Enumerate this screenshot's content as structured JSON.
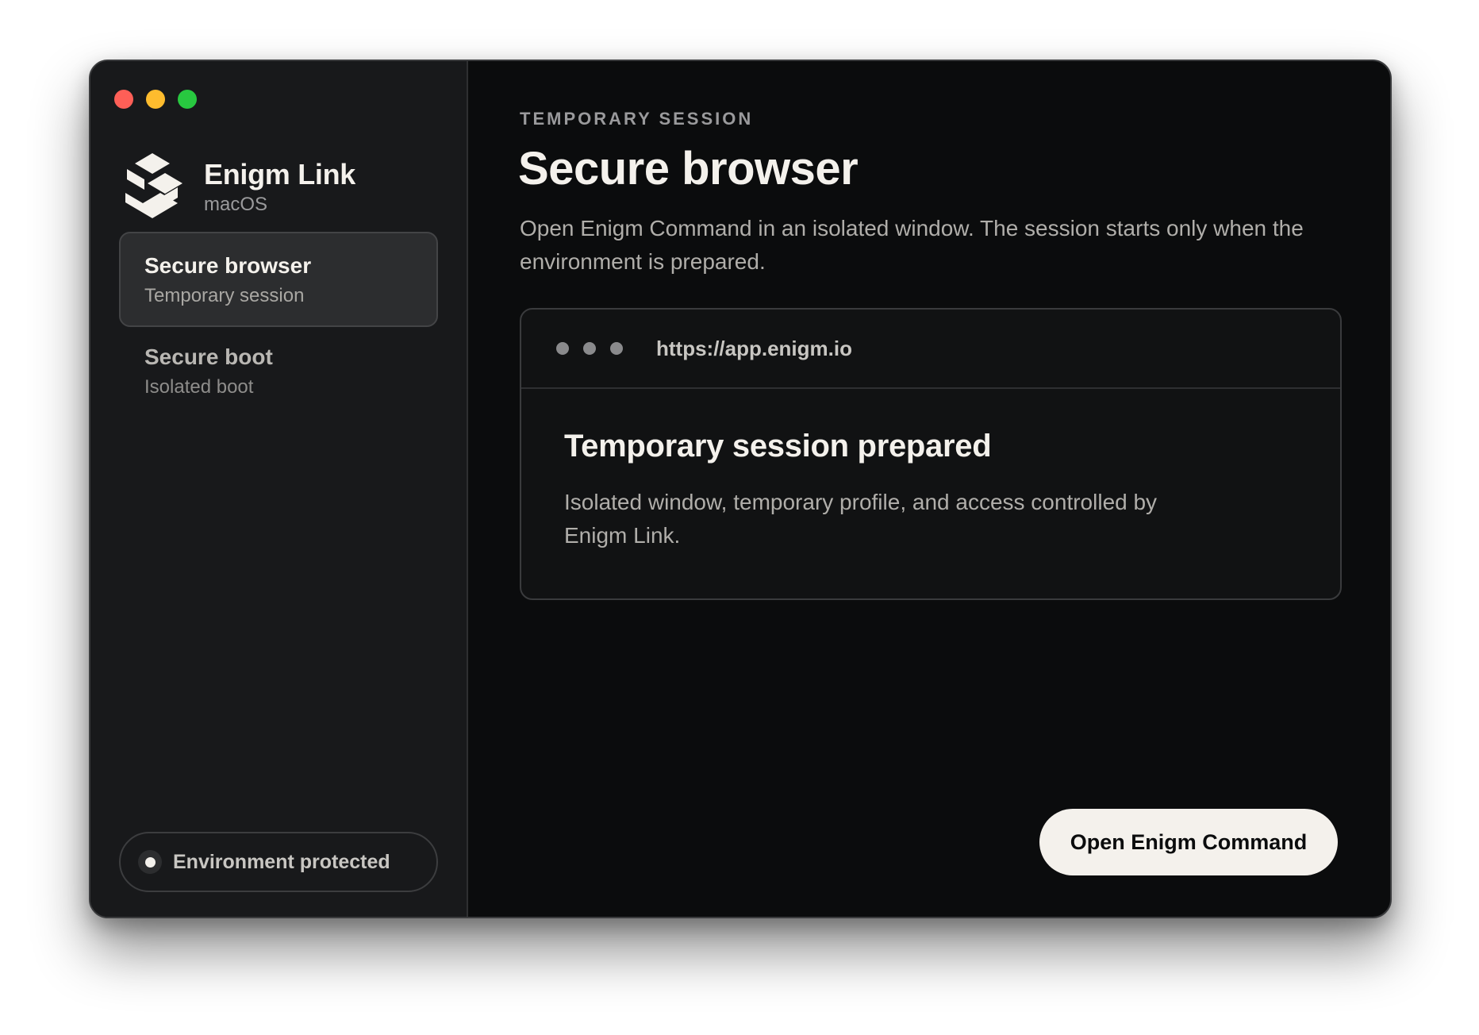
{
  "app": {
    "name": "Enigm Link",
    "platform": "macOS",
    "logo_icon": "enigm-logo-icon"
  },
  "window_controls": [
    "close",
    "minimize",
    "zoom"
  ],
  "sidebar": {
    "items": [
      {
        "title": "Secure browser",
        "subtitle": "Temporary session",
        "active": true
      },
      {
        "title": "Secure boot",
        "subtitle": "Isolated boot",
        "active": false
      }
    ],
    "status": {
      "label": "Environment protected"
    }
  },
  "main": {
    "eyebrow": "TEMPORARY SESSION",
    "title": "Secure browser",
    "description": "Open Enigm Command in an isolated window. The session starts only when the environment is prepared.",
    "preview": {
      "url": "https://app.enigm.io",
      "heading": "Temporary session prepared",
      "text": "Isolated window, temporary profile, and access controlled by Enigm Link."
    },
    "primary_button": "Open Enigm Command"
  },
  "colors": {
    "background": "#0b0c0d",
    "sidebar": "#18191b",
    "text_primary": "#f4f1ec",
    "text_secondary": "#b0aeaa",
    "button_bg": "#f4f1ec",
    "traffic_red": "#fe5f57",
    "traffic_yellow": "#febc2e",
    "traffic_green": "#28c840"
  }
}
